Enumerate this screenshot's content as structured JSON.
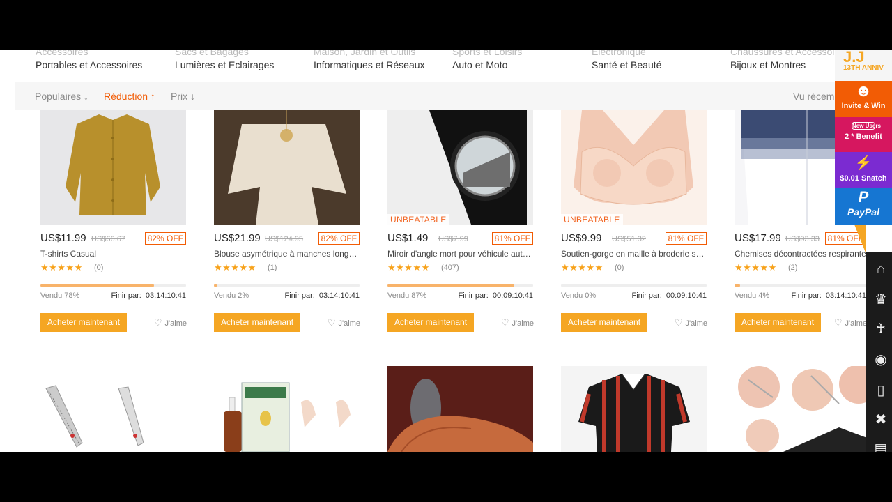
{
  "categories_top": [
    "Accessoires",
    "Sacs et Bagages",
    "Maison, Jardin et Outils",
    "Sports et Loisirs",
    "Electronique",
    "Chaussures et Accessoires"
  ],
  "categories": [
    "Portables et Accessoires",
    "Lumières et Eclairages",
    "Informatiques et Réseaux",
    "Auto et Moto",
    "Santé et Beauté",
    "Bijoux et Montres"
  ],
  "sort": {
    "popular": "Populaires ↓",
    "discount": "Réduction ↑",
    "price": "Prix ↓",
    "recent": "Vu récemment"
  },
  "product_labels": {
    "buy": "Acheter maintenant",
    "like": "J'aime",
    "ends": "Finir par:"
  },
  "products": [
    {
      "price": "US$11.99",
      "old_price": "US$66.67",
      "off": "82% OFF",
      "title": "T-shirts Casual",
      "stars": "★★★★★",
      "reviews": "(0)",
      "sold": "Vendu 78%",
      "sold_fraction": 0.78,
      "time": "03:14:10:41",
      "badge": ""
    },
    {
      "price": "US$21.99",
      "old_price": "US$124.95",
      "off": "82% OFF",
      "title": "Blouse asymétrique à manches longues",
      "stars": "★★★★★",
      "reviews": "(1)",
      "sold": "Vendu 2%",
      "sold_fraction": 0.02,
      "time": "03:14:10:41",
      "badge": ""
    },
    {
      "price": "US$1.49",
      "old_price": "US$7.99",
      "off": "81% OFF",
      "title": "Miroir d'angle mort pour véhicule automobile",
      "stars": "★★★★★",
      "reviews": "(407)",
      "sold": "Vendu 87%",
      "sold_fraction": 0.87,
      "time": "00:09:10:41",
      "badge": "UNBEATABLE"
    },
    {
      "price": "US$9.99",
      "old_price": "US$51.32",
      "off": "81% OFF",
      "title": "Soutien-gorge en maille à broderie sans armature",
      "stars": "★★★★★",
      "reviews": "(0)",
      "sold": "Vendu 0%",
      "sold_fraction": 0.0,
      "time": "00:09:10:41",
      "badge": "UNBEATABLE"
    },
    {
      "price": "US$17.99",
      "old_price": "US$93.33",
      "off": "81% OFF",
      "title": "Chemises décontractées respirantes",
      "stars": "★★★★★",
      "reviews": "(2)",
      "sold": "Vendu 4%",
      "sold_fraction": 0.04,
      "time": "03:14:10:41",
      "badge": ""
    }
  ],
  "promo": {
    "anniversary": "13TH ANNIV",
    "invite": "Invite & Win",
    "new_users": "New Users",
    "benefit": "2 * Benefit",
    "snatch": "$0.01 Snatch",
    "paypal": "PayPal"
  },
  "side_icons": [
    "home-icon",
    "crown-icon",
    "high-heel-icon",
    "bra-icon",
    "phone-icon",
    "drone-icon",
    "tablet-icon"
  ],
  "colors": {
    "accent": "#f25c05",
    "button": "#f5a623",
    "star": "#f7a21b"
  }
}
